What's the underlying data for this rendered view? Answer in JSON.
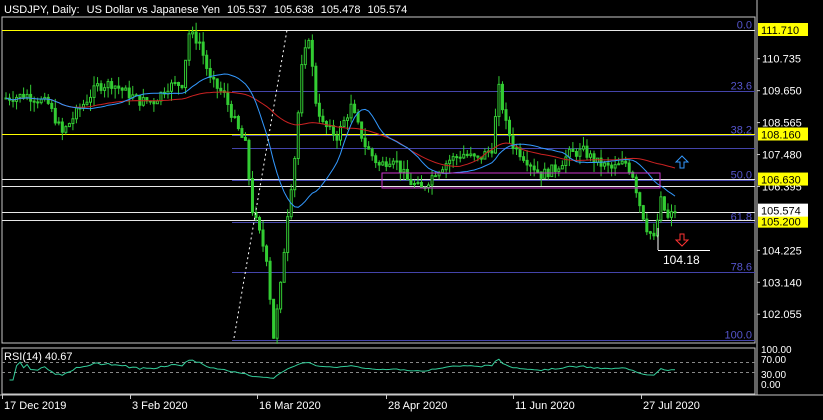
{
  "header": {
    "symbol": "USDJPY, Daily:",
    "description": "US Dollar vs Japanese Yen",
    "open": "105.537",
    "high": "105.638",
    "low": "105.478",
    "close": "105.574"
  },
  "fib": {
    "levels": [
      {
        "label": "0.0",
        "price": 111.71
      },
      {
        "label": "23.6",
        "price": 109.65
      },
      {
        "label": "38.2",
        "price": 108.16
      },
      {
        "label": "50.0",
        "price": 106.63
      },
      {
        "label": "61.8",
        "price": 105.2
      },
      {
        "label": "78.6",
        "price": 103.5
      },
      {
        "label": "100.0",
        "price": 101.18
      }
    ]
  },
  "price_axis": {
    "ticks": [
      "110.735",
      "109.650",
      "108.565",
      "107.480",
      "106.395",
      "104.225",
      "103.140",
      "102.055"
    ],
    "tick_values": [
      110.735,
      109.65,
      108.565,
      107.48,
      106.395,
      104.225,
      103.14,
      102.055
    ],
    "highlights": [
      {
        "label": "111.710",
        "price": 111.71
      },
      {
        "label": "108.160",
        "price": 108.16
      },
      {
        "label": "106.630",
        "price": 106.63
      },
      {
        "label": "105.200",
        "price": 105.2
      }
    ],
    "current": {
      "label": "105.574",
      "price": 105.574
    }
  },
  "annotation": {
    "target_label": "104.18"
  },
  "rsi": {
    "label": "RSI(14) 40.67",
    "levels": [
      "100.00",
      "70.00",
      "30.00",
      "0.00"
    ]
  },
  "time_axis": {
    "labels": [
      "17 Dec 2019",
      "3 Feb 2020",
      "16 Mar 2020",
      "28 Apr 2020",
      "11 Jun 2020",
      "27 Jul 2020"
    ]
  },
  "colors": {
    "background": "#000000",
    "candle": "#33cc33",
    "ma_fast": "#3399ff",
    "ma_slow": "#cc2222",
    "fib_line": "#4444aa",
    "horizontal_line": "#e8e8e8",
    "yellow_line": "#ffff00",
    "label_highlight": "#ffff00",
    "box": "#cc33cc",
    "arrow_up": "#3399ff",
    "arrow_down": "#ff3333",
    "rsi_line": "#33cc99"
  },
  "chart_data": {
    "type": "candlestick",
    "series_shape": [
      [
        0,
        109.4
      ],
      [
        6,
        109.5
      ],
      [
        12,
        109.2
      ],
      [
        16,
        108.2
      ],
      [
        20,
        108.9
      ],
      [
        26,
        109.8
      ],
      [
        30,
        109.9
      ],
      [
        34,
        109.6
      ],
      [
        38,
        109.3
      ],
      [
        42,
        109.3
      ],
      [
        46,
        109.8
      ],
      [
        50,
        109.9
      ],
      [
        52,
        111.6
      ],
      [
        55,
        111.3
      ],
      [
        58,
        110.0
      ],
      [
        62,
        109.5
      ],
      [
        66,
        108.3
      ],
      [
        68,
        107.8
      ],
      [
        70,
        105.6
      ],
      [
        74,
        104.0
      ],
      [
        76,
        101.3
      ],
      [
        78,
        103.0
      ],
      [
        80,
        105.5
      ],
      [
        82,
        107.4
      ],
      [
        84,
        110.4
      ],
      [
        86,
        111.5
      ],
      [
        88,
        109.3
      ],
      [
        90,
        108.5
      ],
      [
        94,
        108.1
      ],
      [
        98,
        109.1
      ],
      [
        102,
        107.8
      ],
      [
        106,
        107.1
      ],
      [
        110,
        107.4
      ],
      [
        114,
        106.6
      ],
      [
        118,
        106.3
      ],
      [
        122,
        106.9
      ],
      [
        126,
        107.3
      ],
      [
        130,
        107.5
      ],
      [
        134,
        107.3
      ],
      [
        138,
        107.7
      ],
      [
        140,
        109.7
      ],
      [
        142,
        108.5
      ],
      [
        144,
        107.8
      ],
      [
        148,
        107.3
      ],
      [
        152,
        106.8
      ],
      [
        156,
        107.0
      ],
      [
        160,
        107.5
      ],
      [
        164,
        107.6
      ],
      [
        168,
        107.2
      ],
      [
        172,
        107.0
      ],
      [
        176,
        107.2
      ],
      [
        178,
        106.8
      ],
      [
        180,
        105.8
      ],
      [
        182,
        105.0
      ],
      [
        184,
        104.6
      ],
      [
        186,
        105.9
      ],
      [
        188,
        105.3
      ],
      [
        190,
        105.57
      ]
    ]
  }
}
